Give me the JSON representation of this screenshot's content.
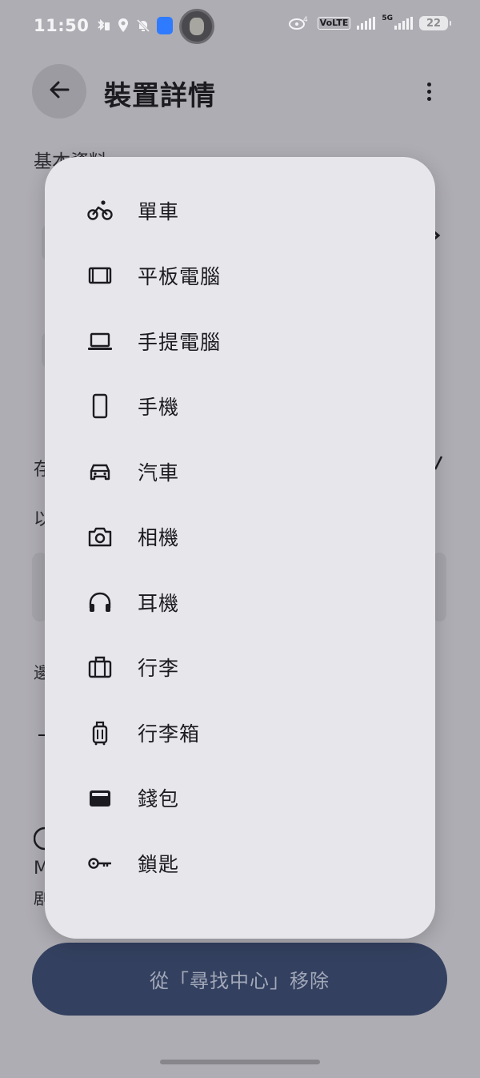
{
  "status_bar": {
    "time": "11:50",
    "volte": "VoLTE",
    "network": "5G",
    "battery": "22"
  },
  "header": {
    "title": "裝置詳情"
  },
  "background": {
    "section_title": "基本資料",
    "fragment_1": "存",
    "fragment_2": "以",
    "fragment_3": "邊",
    "fragment_4": "M",
    "fragment_5": "剧"
  },
  "menu": {
    "items": [
      {
        "label": "單車",
        "icon": "bike-icon"
      },
      {
        "label": "平板電腦",
        "icon": "tablet-icon"
      },
      {
        "label": "手提電腦",
        "icon": "laptop-icon"
      },
      {
        "label": "手機",
        "icon": "phone-icon"
      },
      {
        "label": "汽車",
        "icon": "car-icon"
      },
      {
        "label": "相機",
        "icon": "camera-icon"
      },
      {
        "label": "耳機",
        "icon": "headphones-icon"
      },
      {
        "label": "行李",
        "icon": "luggage-icon"
      },
      {
        "label": "行李箱",
        "icon": "suitcase-icon"
      },
      {
        "label": "錢包",
        "icon": "wallet-icon"
      },
      {
        "label": "鎖匙",
        "icon": "key-icon"
      }
    ]
  },
  "actions": {
    "remove_label": "從「尋找中心」移除"
  },
  "colors": {
    "scrim": "#aeadb3",
    "menu_bg": "#e7e6eb",
    "button_bg": "#33405f"
  }
}
